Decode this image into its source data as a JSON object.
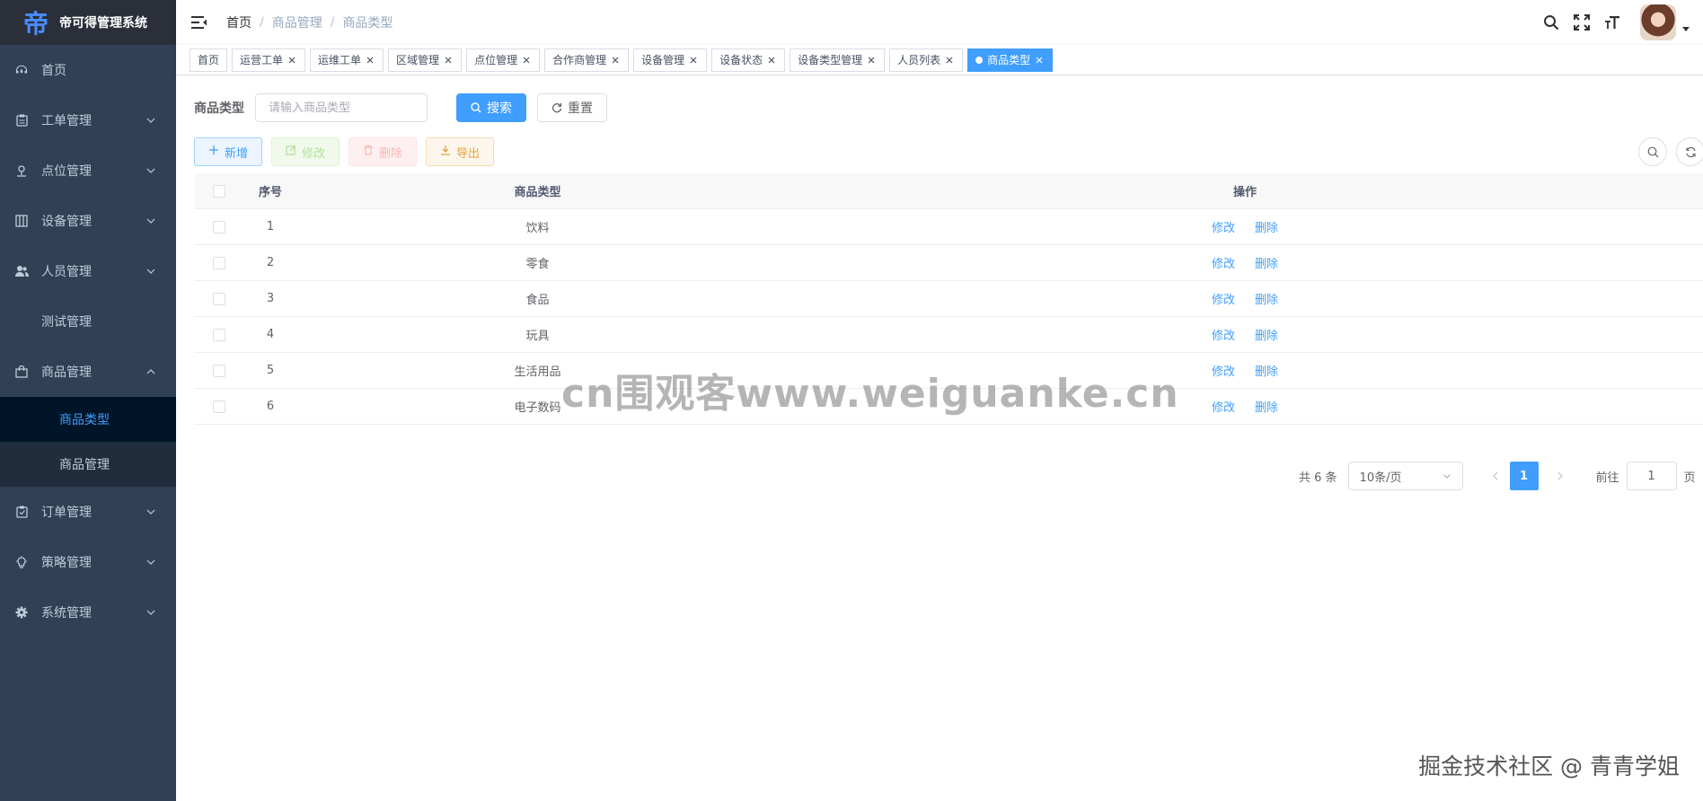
{
  "app": {
    "logo_glyph": "帝",
    "title": "帝可得管理系统"
  },
  "colors": {
    "primary": "#409eff",
    "sidebar_bg": "#304156",
    "sidebar_text": "#bfcbd9"
  },
  "sidebar": {
    "items": [
      {
        "label": "首页",
        "icon": "dashboard-icon"
      },
      {
        "label": "工单管理",
        "icon": "clipboard-icon"
      },
      {
        "label": "点位管理",
        "icon": "location-icon"
      },
      {
        "label": "设备管理",
        "icon": "device-icon"
      },
      {
        "label": "人员管理",
        "icon": "people-icon"
      },
      {
        "label": "测试管理"
      },
      {
        "label": "商品管理",
        "icon": "bag-icon",
        "expanded": true
      },
      {
        "label": "订单管理",
        "icon": "order-icon"
      },
      {
        "label": "策略管理",
        "icon": "bulb-icon"
      },
      {
        "label": "系统管理",
        "icon": "gear-icon"
      }
    ],
    "sub_items": [
      {
        "label": "商品类型",
        "active": true
      },
      {
        "label": "商品管理"
      }
    ]
  },
  "breadcrumb": [
    "首页",
    "商品管理",
    "商品类型"
  ],
  "tags": [
    "首页",
    "运营工单",
    "运维工单",
    "区域管理",
    "点位管理",
    "合作商管理",
    "设备管理",
    "设备状态",
    "设备类型管理",
    "人员列表",
    "商品类型"
  ],
  "search": {
    "label": "商品类型",
    "placeholder": "请输入商品类型",
    "search_btn": "搜索",
    "reset_btn": "重置"
  },
  "toolbar": {
    "add": "新增",
    "edit": "修改",
    "delete": "删除",
    "export": "导出"
  },
  "table": {
    "headers": {
      "index": "序号",
      "type": "商品类型",
      "ops": "操作"
    },
    "rows": [
      {
        "index": "1",
        "type": "饮料"
      },
      {
        "index": "2",
        "type": "零食"
      },
      {
        "index": "3",
        "type": "食品"
      },
      {
        "index": "4",
        "type": "玩具"
      },
      {
        "index": "5",
        "type": "生活用品"
      },
      {
        "index": "6",
        "type": "电子数码"
      }
    ],
    "row_ops": {
      "edit": "修改",
      "delete": "删除"
    }
  },
  "pagination": {
    "total": "共 6 条",
    "page_size": "10条/页",
    "current": "1",
    "goto_label": "前往",
    "goto_value": "1",
    "page_suffix": "页"
  },
  "watermark": "cn围观客www.weiguanke.cn",
  "credit": "掘金技术社区 @ 青青学姐"
}
